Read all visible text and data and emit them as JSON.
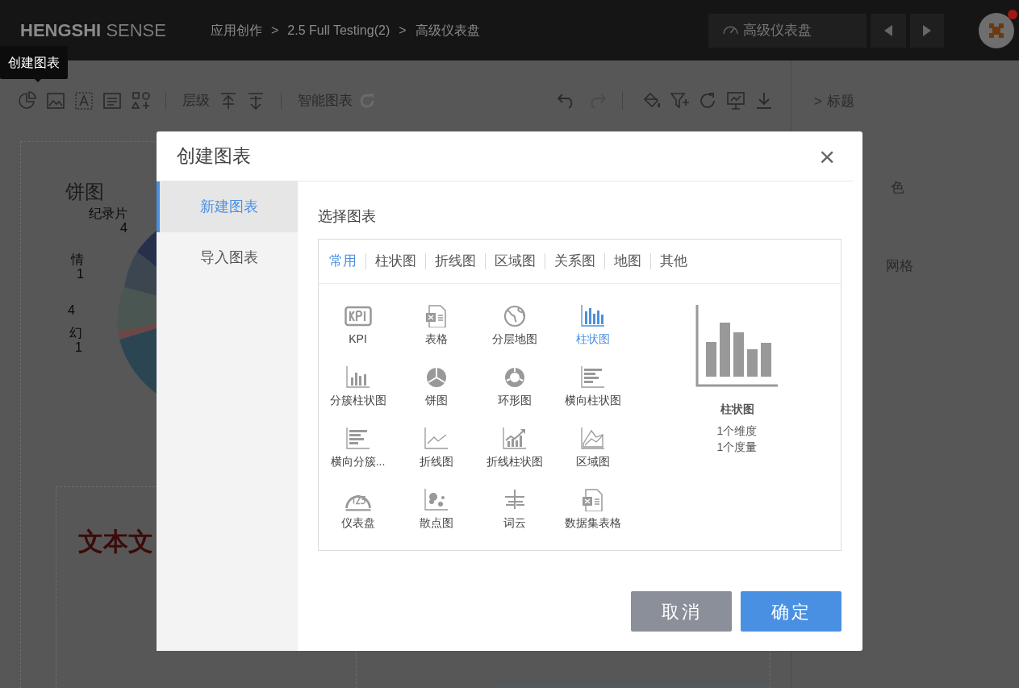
{
  "header": {
    "logo_bold": "HENGSHI",
    "logo_light": "SENSE",
    "breadcrumb": [
      {
        "label": "应用创作"
      },
      {
        "separator": ">",
        "label": "2.5 Full Testing(2)"
      },
      {
        "separator": ">",
        "label": "高级仪表盘"
      }
    ],
    "dashboard_selector": "高级仪表盘"
  },
  "tooltip": "创建图表",
  "toolbar": {
    "layer_label": "层级",
    "smart_chart_label": "智能图表"
  },
  "right_panel": {
    "items": [
      {
        "chevron": ">",
        "label": "标题"
      },
      {
        "label": "色"
      },
      {
        "label": "网格"
      }
    ]
  },
  "canvas": {
    "pie_title": "饼图",
    "pie_labels": [
      {
        "label": "纪录片",
        "value": "4"
      },
      {
        "label": "情",
        "value": "1"
      },
      {
        "value": "4"
      },
      {
        "label": "幻",
        "value": "1"
      }
    ],
    "text_card": "文本文"
  },
  "dialog": {
    "title": "创建图表",
    "close": "×",
    "sidebar": [
      {
        "label": "新建图表",
        "selected": true
      },
      {
        "label": "导入图表",
        "selected": false
      }
    ],
    "section_title": "选择图表",
    "tabs": [
      {
        "label": "常用",
        "selected": true
      },
      {
        "label": "柱状图",
        "selected": false
      },
      {
        "label": "折线图",
        "selected": false
      },
      {
        "label": "区域图",
        "selected": false
      },
      {
        "label": "关系图",
        "selected": false
      },
      {
        "label": "地图",
        "selected": false
      },
      {
        "label": "其他",
        "selected": false
      }
    ],
    "chart_types": [
      {
        "kind": "kpi",
        "label": "KPI",
        "selected": false
      },
      {
        "kind": "table",
        "label": "表格",
        "selected": false
      },
      {
        "kind": "globe",
        "label": "分层地图",
        "selected": false
      },
      {
        "kind": "bar",
        "label": "柱状图",
        "selected": true
      },
      {
        "kind": "cluster",
        "label": "分簇柱状图",
        "selected": false
      },
      {
        "kind": "pie",
        "label": "饼图",
        "selected": false
      },
      {
        "kind": "donut",
        "label": "环形图",
        "selected": false
      },
      {
        "kind": "hbar",
        "label": "横向柱状图",
        "selected": false
      },
      {
        "kind": "hbar",
        "label": "横向分簇...",
        "selected": false
      },
      {
        "kind": "line",
        "label": "折线图",
        "selected": false
      },
      {
        "kind": "linebar",
        "label": "折线柱状图",
        "selected": false
      },
      {
        "kind": "area",
        "label": "区域图",
        "selected": false
      },
      {
        "kind": "gauge",
        "label": "仪表盘",
        "selected": false
      },
      {
        "kind": "scatter",
        "label": "散点图",
        "selected": false
      },
      {
        "kind": "wordcloud",
        "label": "词云",
        "selected": false
      },
      {
        "kind": "table",
        "label": "数据集表格",
        "selected": false
      }
    ],
    "preview": {
      "title": "柱状图",
      "lines": [
        "1个维度",
        "1个度量"
      ]
    },
    "buttons": [
      {
        "kind": "secondary",
        "label": "取消"
      },
      {
        "kind": "primary",
        "label": "确定"
      }
    ]
  }
}
